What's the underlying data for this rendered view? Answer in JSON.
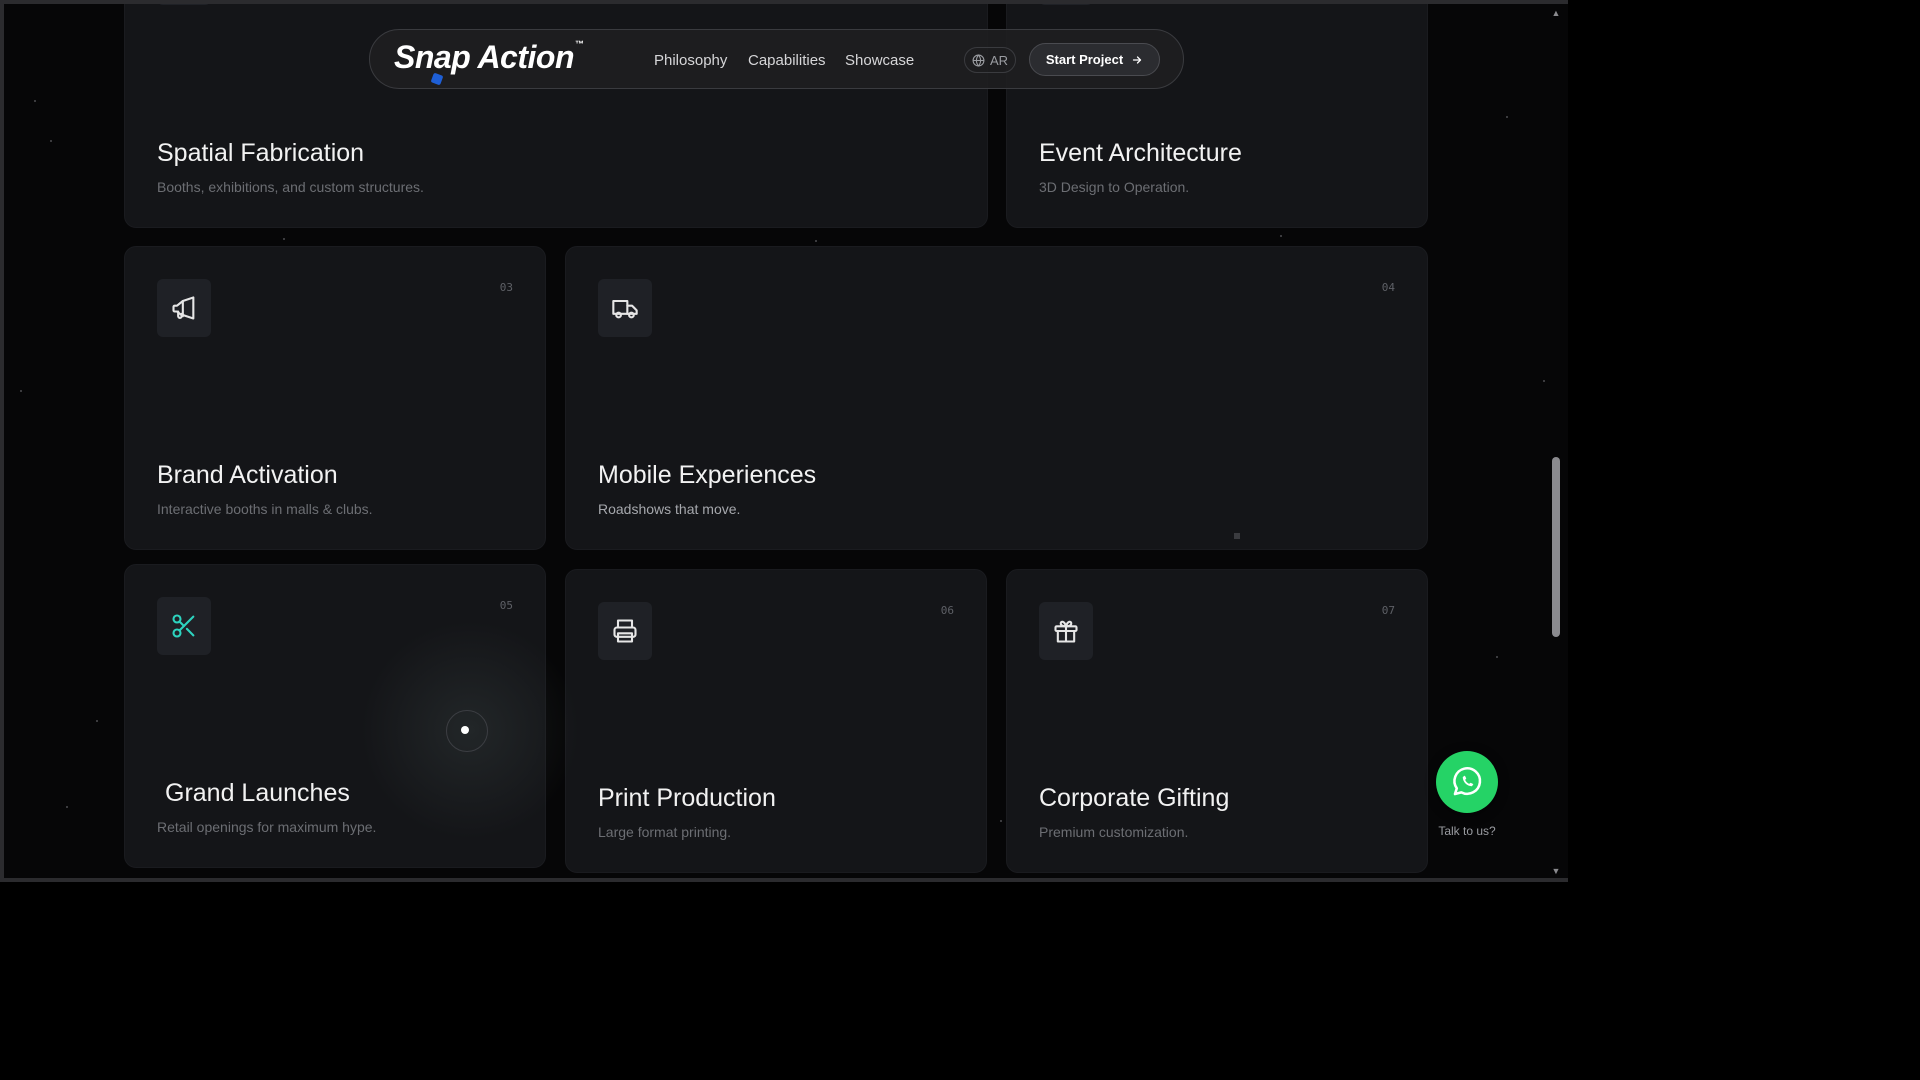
{
  "nav": {
    "logo_text": "Snap Action",
    "logo_tm": "™",
    "links": [
      "Philosophy",
      "Capabilities",
      "Showcase"
    ],
    "lang_label": "AR",
    "cta_label": "Start Project",
    "cta_icon": "arrow-right-icon"
  },
  "cards": [
    {
      "title": "Spatial Fabrication",
      "desc": "Booths, exhibitions, and custom structures."
    },
    {
      "title": "Event Architecture",
      "desc": "3D Design to Operation."
    },
    {
      "number": "03",
      "icon": "megaphone-icon",
      "title": "Brand Activation",
      "desc": "Interactive booths in malls & clubs."
    },
    {
      "number": "04",
      "icon": "truck-icon",
      "title": "Mobile Experiences",
      "desc": "Roadshows that move."
    },
    {
      "number": "05",
      "icon": "scissors-icon",
      "title": "Grand Launches",
      "desc": "Retail openings for maximum hype."
    },
    {
      "number": "06",
      "icon": "printer-icon",
      "title": "Print Production",
      "desc": "Large format printing."
    },
    {
      "number": "07",
      "icon": "gift-icon",
      "title": "Corporate Gifting",
      "desc": "Premium customization."
    }
  ],
  "whatsapp": {
    "icon": "whatsapp-icon",
    "label": "Talk to us?",
    "color": "#25d366"
  },
  "colors": {
    "background": "#060607",
    "card": "#141518",
    "accent_icon": "#2dd4bf"
  }
}
